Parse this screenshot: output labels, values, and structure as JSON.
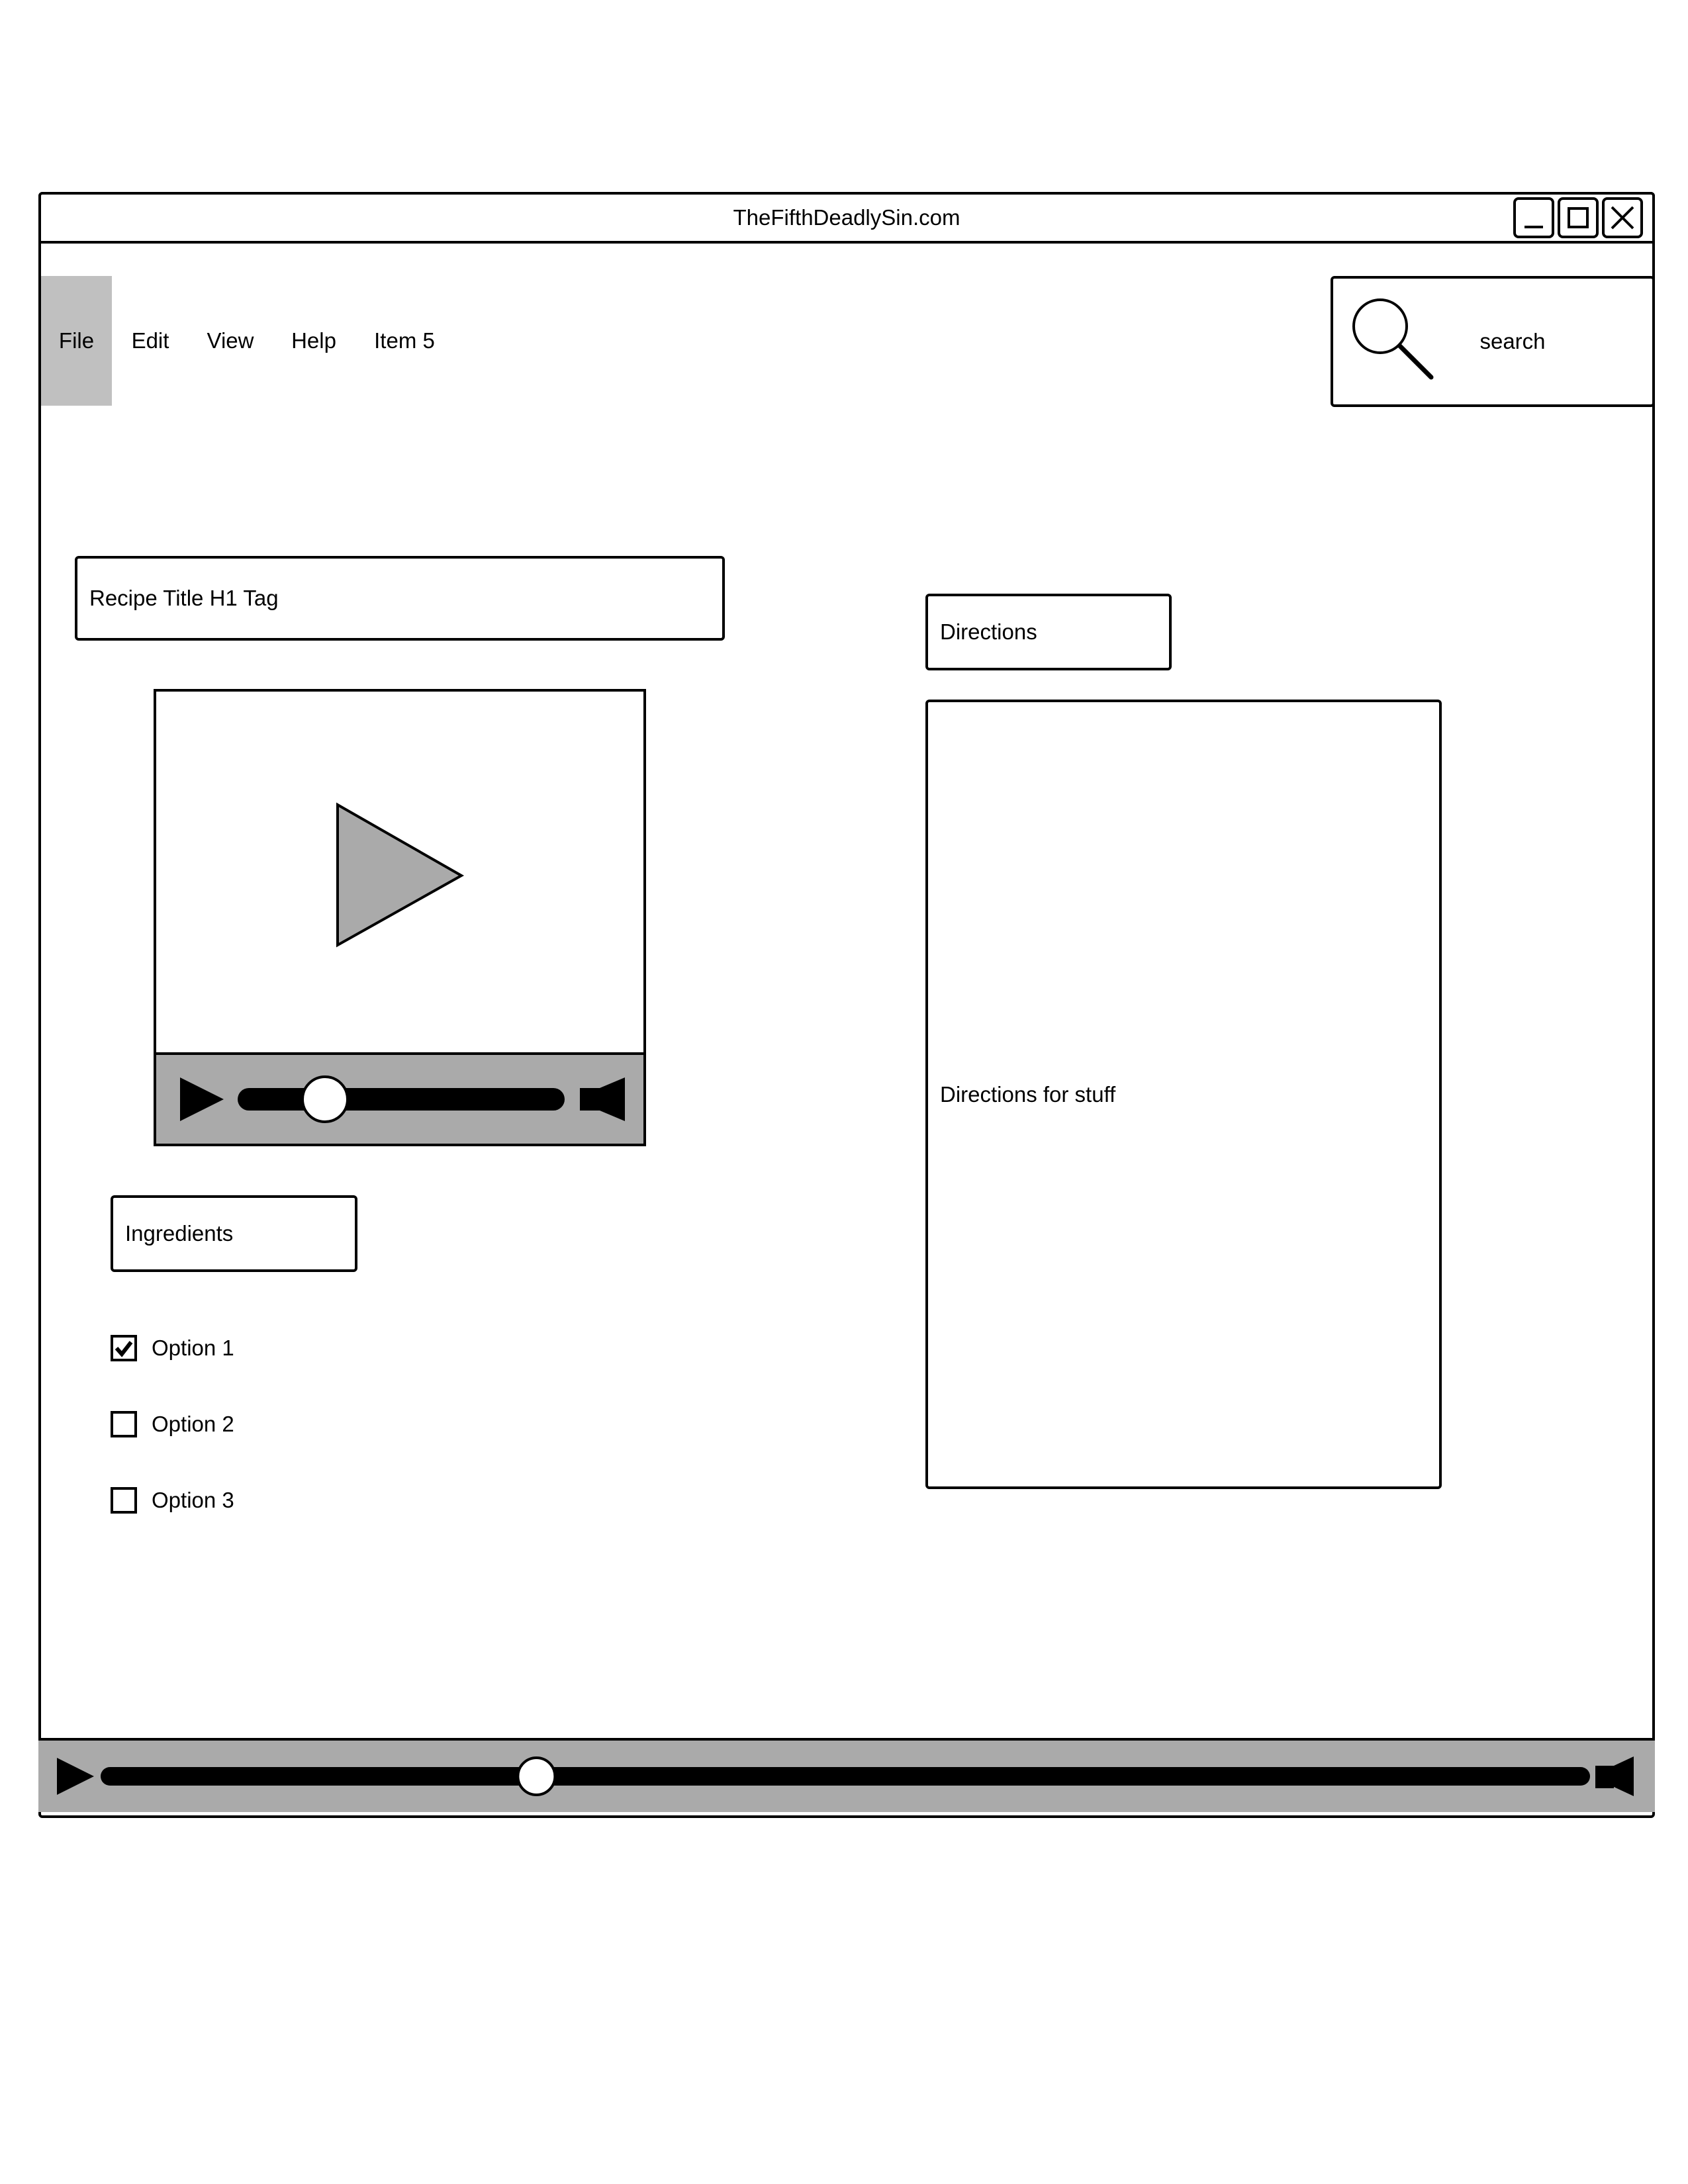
{
  "window": {
    "title": "TheFifthDeadlySin.com",
    "controls": [
      "minimize-icon",
      "maximize-icon",
      "close-icon"
    ]
  },
  "menu": {
    "items": [
      {
        "label": "File",
        "selected": true
      },
      {
        "label": "Edit",
        "selected": false
      },
      {
        "label": "View",
        "selected": false
      },
      {
        "label": "Help",
        "selected": false
      },
      {
        "label": "Item 5",
        "selected": false
      }
    ]
  },
  "search": {
    "label": "search",
    "icon": "search-icon"
  },
  "recipe": {
    "title": "Recipe Title H1 Tag"
  },
  "video": {
    "play_icon": "play-icon",
    "progress": 0.25,
    "volume_icon": "volume-icon"
  },
  "ingredients": {
    "header": "Ingredients",
    "options": [
      {
        "label": "Option 1",
        "checked": true
      },
      {
        "label": "Option 2",
        "checked": false
      },
      {
        "label": "Option 3",
        "checked": false
      }
    ]
  },
  "directions": {
    "header": "Directions",
    "body": "Directions for stuff"
  },
  "bottom_player": {
    "progress": 0.29,
    "play_icon": "play-icon",
    "volume_icon": "volume-icon"
  },
  "colors": {
    "selected_menu_bg": "#c0c0c0",
    "player_bg": "#aaaaaa",
    "play_triangle_fill": "#aaaaaa"
  }
}
